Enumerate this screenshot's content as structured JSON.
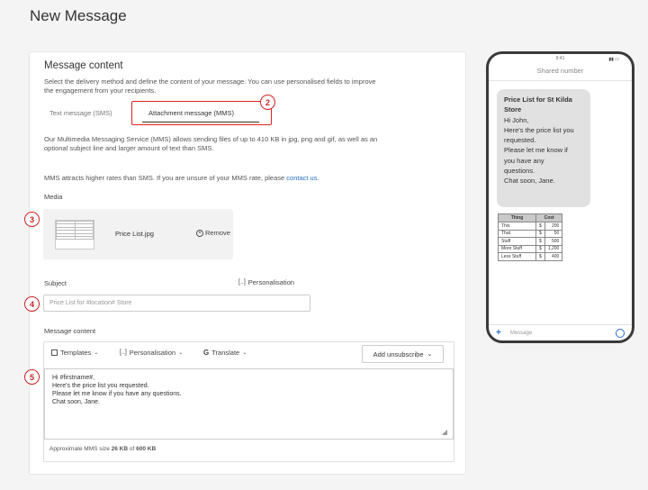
{
  "page": {
    "title": "New Message"
  },
  "content": {
    "section_title": "Message content",
    "description_line1": "Select the delivery method and define the content of your message. You can use personalised fields to improve",
    "description_line2": "the engagement from your recipients.",
    "tabs": [
      {
        "label": "Text message (SMS)",
        "active": false
      },
      {
        "label": "Attachment message (MMS)",
        "active": true
      }
    ],
    "mms_info_line1": "Our Multimedia Messaging Service (MMS) allows sending files of up to 410 KB in jpg, png and gif, as well as an",
    "mms_info_line2": "optional subject line and larger amount of text than SMS.",
    "rates_text": "MMS attracts higher rates than SMS. If you are unsure of your MMS rate, please",
    "rates_link": "contact us",
    "rates_end": "."
  },
  "media": {
    "label": "Media",
    "file_name": "Price List.jpg",
    "remove_label": "Remove",
    "remove_icon": "remove-circle-icon"
  },
  "subject": {
    "label": "Subject",
    "personalisation_label": "Personalisation",
    "value": "Price List for #location# Store"
  },
  "message": {
    "label": "Message content",
    "templates_label": "Templates",
    "personalisation_label": "Personalisation",
    "translate_label": "Translate",
    "unsubscribe_label": "Add unsubscribe",
    "lines": [
      "Hi #firstname#,",
      "Here's the price list you requested.",
      "Please let me know if you have any questions.",
      "Chat soon, Jane."
    ],
    "size_prefix": "Approximate MMS size",
    "size_value": "26 KB",
    "size_of": "of",
    "size_max": "600 KB"
  },
  "annotations": [
    "2",
    "3",
    "4",
    "5"
  ],
  "phone": {
    "status_time": "9:41",
    "header": "Shared number",
    "bubble_title_1": "Price List for St Kilda",
    "bubble_title_2": "Store",
    "bubble_lines": [
      "Hi John,",
      "Here's the price list you",
      "requested.",
      "Please let me know if",
      "you have any",
      "questions.",
      "Chat soon, Jane."
    ],
    "table_headers": [
      "Thing",
      "Cost"
    ],
    "table_rows": [
      [
        "This",
        "$",
        "200"
      ],
      [
        "That",
        "$",
        "50"
      ],
      [
        "Stuff",
        "$",
        "500"
      ],
      [
        "More Stuff",
        "$",
        "1,200"
      ],
      [
        "Less Stuff",
        "$",
        "400"
      ]
    ],
    "input_placeholder": "Message"
  },
  "colors": {
    "annotation_red": "#cc2222",
    "link_blue": "#2a6fc9"
  }
}
